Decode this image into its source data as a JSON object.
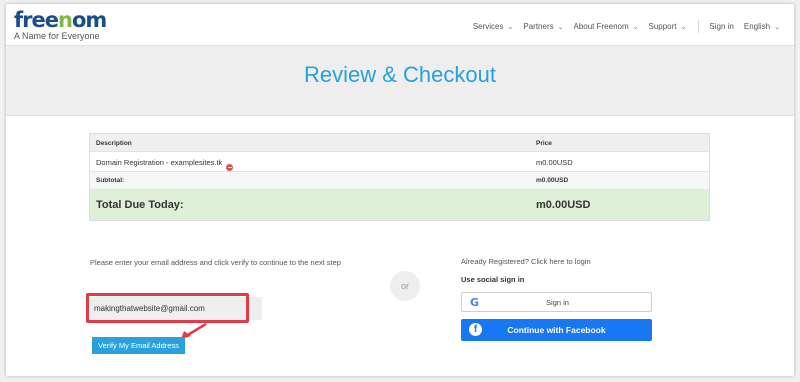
{
  "header": {
    "logo_text": "freenom",
    "tagline": "A Name for Everyone",
    "nav": [
      {
        "label": "Services"
      },
      {
        "label": "Partners"
      },
      {
        "label": "About Freenom"
      },
      {
        "label": "Support"
      }
    ],
    "sign_in": "Sign in",
    "language": "English"
  },
  "banner": {
    "title": "Review & Checkout"
  },
  "order": {
    "headers": {
      "description": "Description",
      "price": "Price"
    },
    "item": {
      "description": "Domain Registration - examplesites.tk",
      "price": "m0.00USD"
    },
    "subtotal": {
      "label": "Subtotal:",
      "value": "m0.00USD"
    },
    "total": {
      "label": "Total Due Today:",
      "value": "m0.00USD"
    }
  },
  "verify": {
    "prompt": "Please enter your email address and click verify to continue to the next step",
    "email_value": "makingthatwebsite@gmail.com",
    "button": "Verify My Email Address"
  },
  "separator": "or",
  "login": {
    "already": "Already Registered? Click here to login",
    "social_label": "Use social sign in",
    "google_button": "Sign in",
    "facebook_button": "Continue with Facebook"
  },
  "colors": {
    "accent": "#2a9fd8",
    "highlight": "#e23b47",
    "total_bg": "#dff0d8",
    "facebook": "#1877f2"
  },
  "icons": [
    "chevron-down-icon",
    "remove-icon",
    "google-icon",
    "facebook-icon",
    "arrow-icon"
  ]
}
